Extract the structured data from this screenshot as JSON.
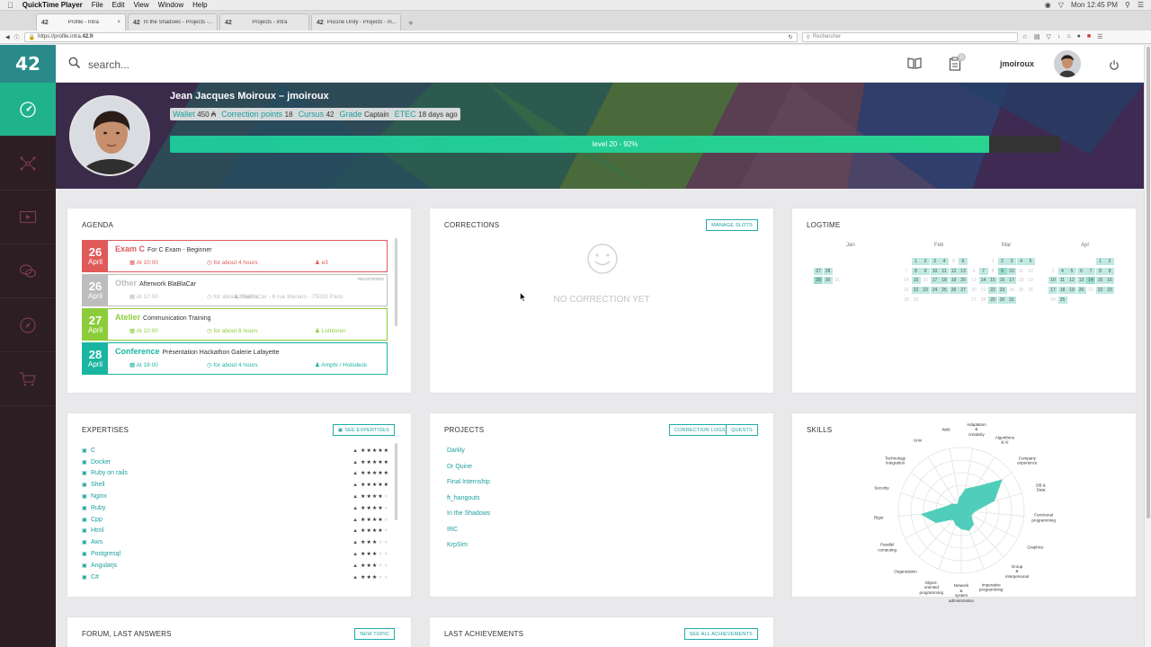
{
  "menubar": {
    "app": "QuickTime Player",
    "items": [
      "File",
      "Edit",
      "View",
      "Window",
      "Help"
    ],
    "clock": "Mon 12:45 PM"
  },
  "browser": {
    "tabs": [
      {
        "label": "Profile - Intra",
        "active": true
      },
      {
        "label": "In the Shadows - Projects -...",
        "active": false
      },
      {
        "label": "Projects - Intra",
        "active": false
      },
      {
        "label": "Piscine Unity - Projects - In...",
        "active": false
      }
    ],
    "url_prefix": "https://profile.intra.",
    "url_bold": "42.fr",
    "search_placeholder": "Rechercher"
  },
  "header": {
    "logo": "42",
    "search_placeholder": "search...",
    "notif_count": "0",
    "username": "jmoiroux"
  },
  "profile": {
    "name": "Jean Jacques Moiroux – jmoiroux",
    "wallet_label": "Wallet",
    "wallet_value": "450 ₳",
    "correction_label": "Correction points",
    "correction_value": "18",
    "cursus_label": "Cursus",
    "cursus_value": "42",
    "grade_label": "Grade",
    "grade_value": "Captain",
    "etec_label": "ETEC",
    "etec_value": "18 days ago",
    "level_text": "level 20 - 92%",
    "level_progress": 0.92
  },
  "agenda": {
    "title": "AGENDA",
    "items": [
      {
        "day": "26",
        "month": "April",
        "kind": "Exam C",
        "name": "For C Exam - Beginner",
        "time": "At 10:00",
        "duration": "for about 4 hours",
        "location": "e3",
        "registered": "",
        "color": "#e05a5a"
      },
      {
        "day": "26",
        "month": "April",
        "kind": "Other",
        "name": "Afterwork BlaBlaCar",
        "time": "At 17:00",
        "duration": "for about 2 hours",
        "location": "BlaBlaCar - 6 rue Ménars - 75002 Paris",
        "registered": "REGISTERED",
        "color": "#bdbdbd"
      },
      {
        "day": "27",
        "month": "April",
        "kind": "Atelier",
        "name": "Communication Training",
        "time": "At 10:00",
        "duration": "for about 8 hours",
        "location": "Lothloren",
        "registered": "",
        "color": "#8ccc3a"
      },
      {
        "day": "28",
        "month": "April",
        "kind": "Conference",
        "name": "Présentation Hackathon Galerie Lafayette",
        "time": "At 16:00",
        "duration": "for about 4 hours",
        "location": "Amphi / Holodeck",
        "registered": "",
        "color": "#1ab5a2"
      }
    ]
  },
  "corrections": {
    "title": "CORRECTIONS",
    "manage_label": "MANAGE SLOTS",
    "empty_text": "NO CORRECTION YET"
  },
  "logtime": {
    "title": "LOGTIME",
    "months": [
      {
        "name": "Jan",
        "rows": [
          [],
          [
            {
              "d": "27",
              "l": 1
            },
            {
              "d": "28",
              "l": 1
            }
          ],
          [
            {
              "d": "29",
              "l": 2
            },
            {
              "d": "30",
              "l": 1
            },
            {
              "d": "31",
              "l": 0
            }
          ]
        ]
      },
      {
        "name": "Feb",
        "rows": [
          [
            {
              "d": "1",
              "l": 1
            },
            {
              "d": "2",
              "l": 1
            },
            {
              "d": "3",
              "l": 1
            },
            {
              "d": "4",
              "l": 1
            },
            {
              "d": "5",
              "l": 0
            },
            {
              "d": "6",
              "l": 1
            }
          ],
          [
            {
              "d": "7",
              "l": 0
            },
            {
              "d": "8",
              "l": 1
            },
            {
              "d": "9",
              "l": 1
            },
            {
              "d": "10",
              "l": 1
            },
            {
              "d": "11",
              "l": 1
            },
            {
              "d": "12",
              "l": 1
            },
            {
              "d": "13",
              "l": 1
            }
          ],
          [
            {
              "d": "14",
              "l": 0
            },
            {
              "d": "15",
              "l": 1
            },
            {
              "d": "16",
              "l": 0
            },
            {
              "d": "17",
              "l": 1
            },
            {
              "d": "18",
              "l": 1
            },
            {
              "d": "19",
              "l": 1
            },
            {
              "d": "20",
              "l": 1
            }
          ],
          [
            {
              "d": "21",
              "l": 0
            },
            {
              "d": "22",
              "l": 1
            },
            {
              "d": "23",
              "l": 1
            },
            {
              "d": "24",
              "l": 1
            },
            {
              "d": "25",
              "l": 1
            },
            {
              "d": "26",
              "l": 1
            },
            {
              "d": "27",
              "l": 1
            }
          ],
          [
            {
              "d": "28",
              "l": 0
            },
            {
              "d": "29",
              "l": 0
            }
          ]
        ]
      },
      {
        "name": "Mar",
        "rows": [
          [
            {
              "d": "1",
              "l": 0
            },
            {
              "d": "2",
              "l": 1
            },
            {
              "d": "3",
              "l": 1
            },
            {
              "d": "4",
              "l": 1
            },
            {
              "d": "5",
              "l": 1
            }
          ],
          [
            {
              "d": "6",
              "l": 0
            },
            {
              "d": "7",
              "l": 1
            },
            {
              "d": "8",
              "l": 0
            },
            {
              "d": "9",
              "l": 2
            },
            {
              "d": "10",
              "l": 1
            },
            {
              "d": "11",
              "l": 0
            },
            {
              "d": "12",
              "l": 0
            }
          ],
          [
            {
              "d": "13",
              "l": 0
            },
            {
              "d": "14",
              "l": 1
            },
            {
              "d": "15",
              "l": 1
            },
            {
              "d": "16",
              "l": 1
            },
            {
              "d": "17",
              "l": 1
            },
            {
              "d": "18",
              "l": 0
            },
            {
              "d": "19",
              "l": 0
            }
          ],
          [
            {
              "d": "20",
              "l": 0
            },
            {
              "d": "21",
              "l": 0
            },
            {
              "d": "22",
              "l": 1
            },
            {
              "d": "23",
              "l": 1
            },
            {
              "d": "24",
              "l": 0
            },
            {
              "d": "25",
              "l": 0
            },
            {
              "d": "26",
              "l": 0
            }
          ],
          [
            {
              "d": "27",
              "l": 0
            },
            {
              "d": "28",
              "l": 0
            },
            {
              "d": "29",
              "l": 1
            },
            {
              "d": "30",
              "l": 1
            },
            {
              "d": "31",
              "l": 1
            }
          ]
        ]
      },
      {
        "name": "Apr",
        "rows": [
          [
            {
              "d": "1",
              "l": 1
            },
            {
              "d": "2",
              "l": 1
            }
          ],
          [
            {
              "d": "3",
              "l": 0
            },
            {
              "d": "4",
              "l": 1
            },
            {
              "d": "5",
              "l": 1
            },
            {
              "d": "6",
              "l": 1
            },
            {
              "d": "7",
              "l": 1
            },
            {
              "d": "8",
              "l": 1
            },
            {
              "d": "9",
              "l": 1
            }
          ],
          [
            {
              "d": "10",
              "l": 1
            },
            {
              "d": "11",
              "l": 1
            },
            {
              "d": "12",
              "l": 1
            },
            {
              "d": "13",
              "l": 1
            },
            {
              "d": "14",
              "l": 2
            },
            {
              "d": "15",
              "l": 1
            },
            {
              "d": "16",
              "l": 1
            }
          ],
          [
            {
              "d": "17",
              "l": 1
            },
            {
              "d": "18",
              "l": 1
            },
            {
              "d": "19",
              "l": 1
            },
            {
              "d": "20",
              "l": 1
            },
            {
              "d": "21",
              "l": 0
            },
            {
              "d": "22",
              "l": 1
            },
            {
              "d": "23",
              "l": 1
            }
          ],
          [
            {
              "d": "24",
              "l": 0
            },
            {
              "d": "25",
              "l": 1
            }
          ]
        ]
      }
    ]
  },
  "expertises": {
    "title": "EXPERTISES",
    "see_label": "SEE EXPERTISES",
    "items": [
      {
        "name": "C",
        "stars": 5
      },
      {
        "name": "Docker",
        "stars": 5
      },
      {
        "name": "Ruby on rails",
        "stars": 5
      },
      {
        "name": "Shell",
        "stars": 5
      },
      {
        "name": "Nginx",
        "stars": 4
      },
      {
        "name": "Ruby",
        "stars": 4
      },
      {
        "name": "Cpp",
        "stars": 4
      },
      {
        "name": "Html",
        "stars": 4
      },
      {
        "name": "Aws",
        "stars": 3
      },
      {
        "name": "Postgresql",
        "stars": 3
      },
      {
        "name": "Angularjs",
        "stars": 3
      },
      {
        "name": "C#",
        "stars": 3
      }
    ]
  },
  "projects": {
    "title": "PROJECTS",
    "logs_label": "CORRECTION LOGS",
    "quests_label": "QUESTS",
    "items": [
      "Darkly",
      "Dr Quine",
      "Final Internship",
      "ft_hangouts",
      "In the Shadows",
      "IRC",
      "KrpSim"
    ]
  },
  "skills": {
    "title": "SKILLS",
    "labels": [
      "Adaptation\n&\ncreativity",
      "Algorithms\n& AI",
      "Company\nexperience",
      "DB &\nData",
      "Functional\nprogramming",
      "Graphics",
      "Group\n&\ninterpersonal",
      "Imperative\nprogramming",
      "Network\n&\nsystem\nadministration",
      "Object-\noriented\nprogramming",
      "Organization",
      "Parallel\ncomputing",
      "Rigor",
      "Security",
      "Technology\nintegration",
      "Unix",
      "Web"
    ],
    "values": [
      0.35,
      0.45,
      0.82,
      0.55,
      0.22,
      0.18,
      0.3,
      0.35,
      0.3,
      0.25,
      0.2,
      0.45,
      0.65,
      0.25,
      0.18,
      0.12,
      0.2
    ],
    "fill_color": "#3ec9b4"
  },
  "forum": {
    "title": "FORUM, LAST ANSWERS",
    "new_label": "NEW TOPIC"
  },
  "achievements": {
    "title": "LAST ACHIEVEMENTS",
    "see_label": "SEE ALL ACHIEVEMENTS"
  }
}
